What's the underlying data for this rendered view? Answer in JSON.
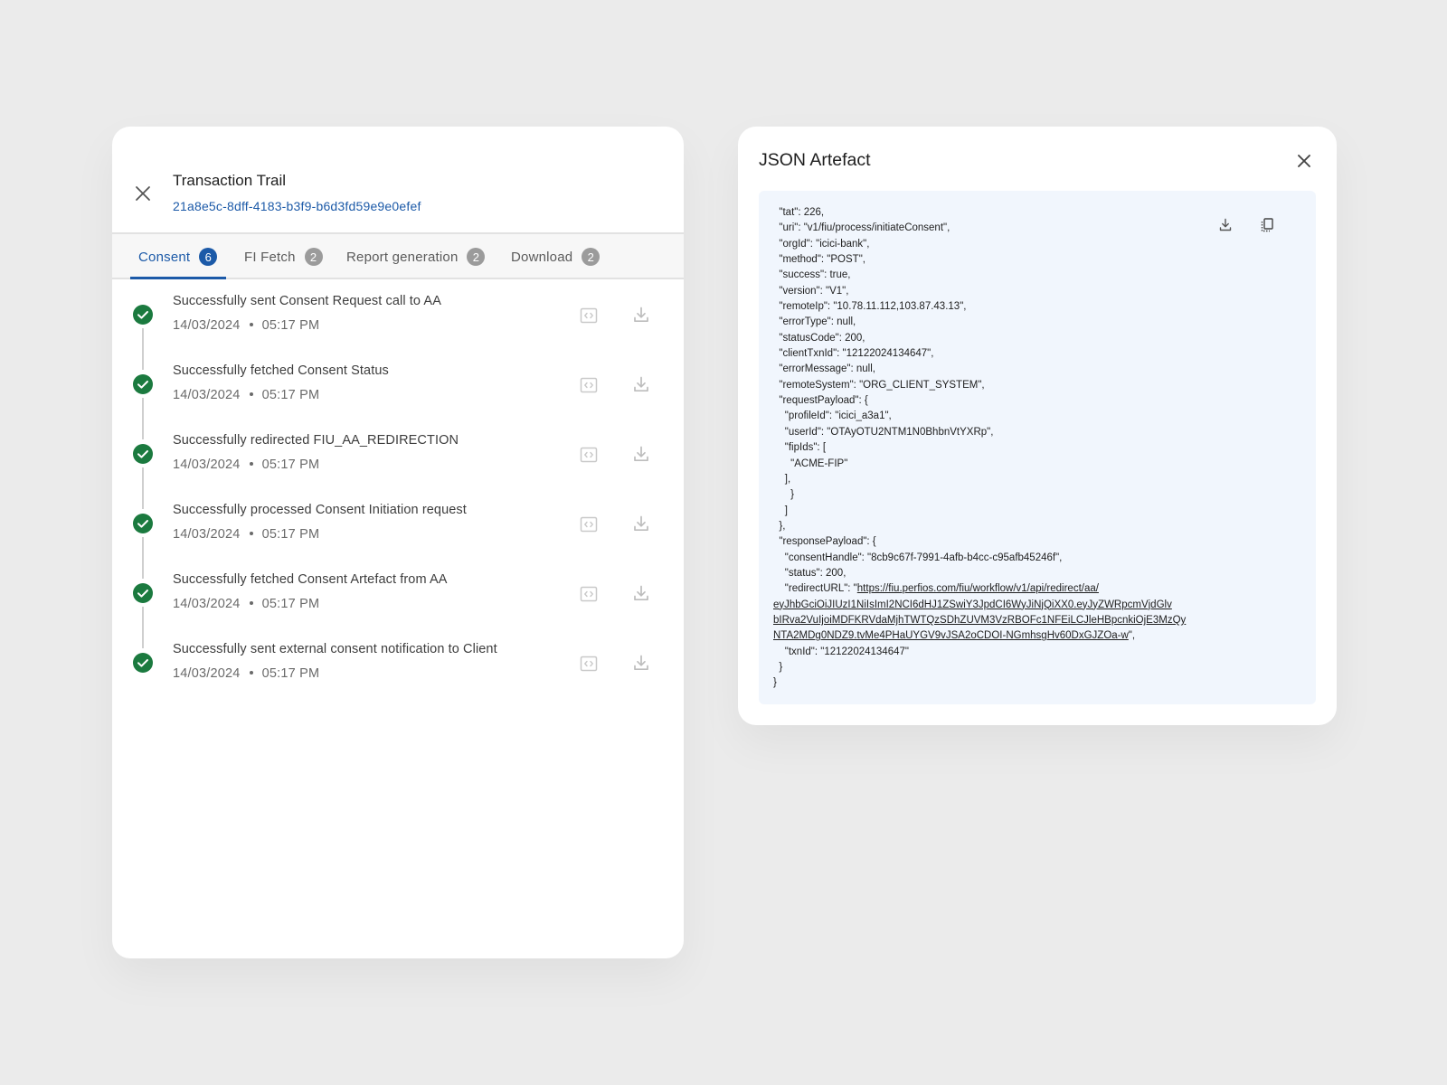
{
  "trail": {
    "title": "Transaction Trail",
    "transaction_id": "21a8e5c-8dff-4183-b3f9-b6d3fd59e9e0efef",
    "close_icon": "close-icon",
    "tabs": [
      {
        "label": "Consent",
        "count": "6",
        "active": true
      },
      {
        "label": "FI Fetch",
        "count": "2",
        "active": false
      },
      {
        "label": "Report generation",
        "count": "2",
        "active": false
      },
      {
        "label": "Download",
        "count": "2",
        "active": false
      }
    ],
    "steps": [
      {
        "title": "Successfully sent Consent Request call to AA",
        "date": "14/03/2024",
        "time": "05:17 PM"
      },
      {
        "title": "Successfully fetched Consent Status",
        "date": "14/03/2024",
        "time": "05:17 PM"
      },
      {
        "title": "Successfully redirected FIU_AA_REDIRECTION",
        "date": "14/03/2024",
        "time": "05:17 PM"
      },
      {
        "title": "Successfully processed Consent Initiation request",
        "date": "14/03/2024",
        "time": "05:17 PM"
      },
      {
        "title": "Successfully fetched Consent Artefact from AA",
        "date": "14/03/2024",
        "time": "05:17 PM"
      },
      {
        "title": "Successfully sent external consent notification to Client",
        "date": "14/03/2024",
        "time": "05:17 PM"
      }
    ]
  },
  "json_artefact": {
    "title": "JSON Artefact",
    "code_before_url": "  \"tat\": 226,\n  \"uri\": \"v1/fiu/process/initiateConsent\",\n  \"orgId\": \"icici-bank\",\n  \"method\": \"POST\",\n  \"success\": true,\n  \"version\": \"V1\",\n  \"remoteIp\": \"10.78.11.112,103.87.43.13\",\n  \"errorType\": null,\n  \"statusCode\": 200,\n  \"clientTxnId\": \"12122024134647\",\n  \"errorMessage\": null,\n  \"remoteSystem\": \"ORG_CLIENT_SYSTEM\",\n  \"requestPayload\": {\n    \"profileId\": \"icici_a3a1\",\n    \"userId\": \"OTAyOTU2NTM1N0BhbnVtYXRp\",\n    \"fipIds\": [\n      \"ACME-FIP\"\n    ],\n      }\n    ]\n  },\n  \"responsePayload\": {\n    \"consentHandle\": \"8cb9c67f-7991-4afb-b4cc-c95afb45246f\",\n    \"status\": 200,\n    \"redirectURL\": \"",
    "redirect_url": "https://fiu.perfios.com/fiu/workflow/v1/api/redirect/aa/\neyJhbGciOiJIUzI1NiIsImI2NCI6dHJ1ZSwiY3JpdCI6WyJiNjQiXX0.eyJyZWRpcmVjdGlv\nbIRva2VuIjoiMDFKRVdaMjhTWTQzSDhZUVM3VzRBOFc1NFEiLCJleHBpcnkiOjE3MzQy\nNTA2MDg0NDZ9.tvMe4PHaUYGV9vJSA2oCDOI-NGmhsgHv60DxGJZOa-w",
    "code_after_url": "\",\n    \"txnId\": \"12122024134647\"\n  }\n}",
    "icons": {
      "download": "download-icon",
      "copy": "copy-icon",
      "close": "close-icon"
    }
  },
  "colors": {
    "accent": "#1c5aa8",
    "success": "#1b7a3f",
    "json_background": "#f1f6fd",
    "page_background": "#ebebeb"
  }
}
